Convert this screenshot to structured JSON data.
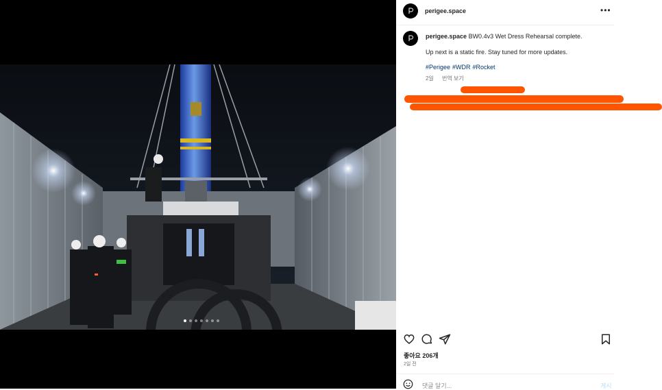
{
  "post": {
    "username": "perigee.space",
    "more_label": "•••",
    "caption_line1": "BW0.4v3 Wet Dress Rehearsal complete.",
    "caption_line2": "Up next is a static fire. Stay tuned for more updates.",
    "hashtags": [
      "#Perigee",
      "#WDR",
      "#Rocket"
    ],
    "caption_age": "2일",
    "translate_label": "번역 보기",
    "likes_text": "좋아요 206개",
    "posted_ago": "2일 전",
    "comment_placeholder": "댓글 달기...",
    "post_button": "게시",
    "carousel": {
      "count": 7,
      "active_index": 0
    }
  },
  "icons": [
    "heart-icon",
    "comment-icon",
    "share-icon",
    "bookmark-icon",
    "emoji-icon",
    "more-options-icon"
  ],
  "colors": {
    "redaction": "#ff5500",
    "hashtag": "#00376b",
    "muted": "#737373",
    "post_button_disabled": "#b2dffc"
  }
}
